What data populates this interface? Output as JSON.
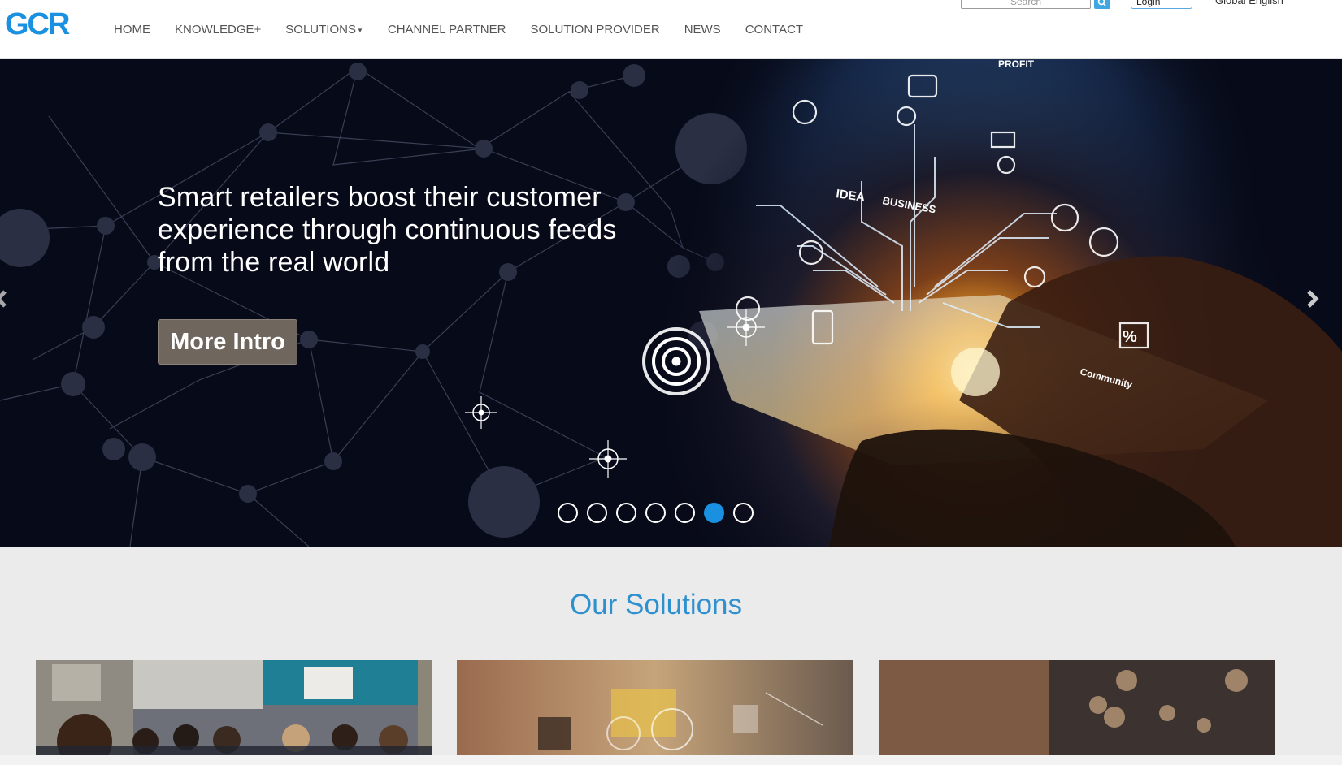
{
  "brand": {
    "logo_text": "GCR",
    "primary_color": "#1a90e0"
  },
  "nav": {
    "items": [
      {
        "label": "HOME",
        "dropdown": false
      },
      {
        "label": "KNOWLEDGE+",
        "dropdown": false
      },
      {
        "label": "SOLUTIONS",
        "dropdown": true
      },
      {
        "label": "CHANNEL PARTNER",
        "dropdown": false
      },
      {
        "label": "SOLUTION PROVIDER",
        "dropdown": false
      },
      {
        "label": "NEWS",
        "dropdown": false
      },
      {
        "label": "CONTACT",
        "dropdown": false
      }
    ]
  },
  "topbar": {
    "search_placeholder": "Search",
    "search_icon": "search-icon",
    "login_label": "Login",
    "language": "Global English"
  },
  "hero": {
    "headline": "Smart retailers boost their customer experience through continuous feeds from the real world",
    "cta_label": "More Intro",
    "illustration_labels": [
      "IDEA",
      "BUSINESS",
      "PROFIT",
      "Community",
      "%"
    ],
    "slide_count": 7,
    "active_slide": 6,
    "prev_icon": "chevron-left-icon",
    "next_icon": "chevron-right-icon"
  },
  "solutions": {
    "title": "Our Solutions",
    "cards": [
      {
        "image": "classroom-photo"
      },
      {
        "image": "business-analytics-photo"
      },
      {
        "image": "retail-bokeh-photo"
      }
    ]
  }
}
